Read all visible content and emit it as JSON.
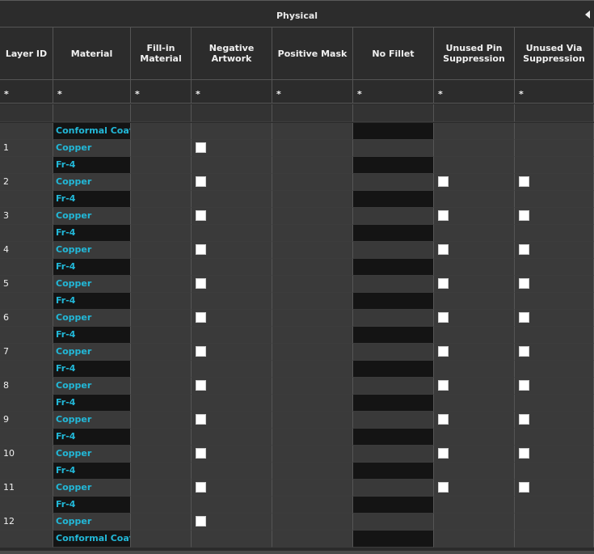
{
  "panel": {
    "title": "Physical"
  },
  "columns": [
    {
      "key": "layer_id",
      "label": "Layer ID"
    },
    {
      "key": "material",
      "label": "Material"
    },
    {
      "key": "fill_in",
      "label": "Fill-in\nMaterial"
    },
    {
      "key": "neg_art",
      "label": "Negative Artwork"
    },
    {
      "key": "pos_mask",
      "label": "Positive Mask"
    },
    {
      "key": "no_fillet",
      "label": "No Fillet"
    },
    {
      "key": "unused_pin",
      "label": "Unused Pin\nSuppression"
    },
    {
      "key": "unused_via",
      "label": "Unused Via\nSuppression"
    }
  ],
  "filter_row": [
    "*",
    "*",
    "*",
    "*",
    "*",
    "*",
    "*",
    "*"
  ],
  "rows": [
    {
      "layer_id": "",
      "material": "Conformal Coat",
      "neg": false,
      "pin": false,
      "via": false
    },
    {
      "layer_id": "1",
      "material": "Copper",
      "neg": true,
      "pin": false,
      "via": false
    },
    {
      "layer_id": "",
      "material": "Fr-4",
      "neg": false,
      "pin": false,
      "via": false
    },
    {
      "layer_id": "2",
      "material": "Copper",
      "neg": true,
      "pin": true,
      "via": true
    },
    {
      "layer_id": "",
      "material": "Fr-4",
      "neg": false,
      "pin": false,
      "via": false
    },
    {
      "layer_id": "3",
      "material": "Copper",
      "neg": true,
      "pin": true,
      "via": true
    },
    {
      "layer_id": "",
      "material": "Fr-4",
      "neg": false,
      "pin": false,
      "via": false
    },
    {
      "layer_id": "4",
      "material": "Copper",
      "neg": true,
      "pin": true,
      "via": true
    },
    {
      "layer_id": "",
      "material": "Fr-4",
      "neg": false,
      "pin": false,
      "via": false
    },
    {
      "layer_id": "5",
      "material": "Copper",
      "neg": true,
      "pin": true,
      "via": true
    },
    {
      "layer_id": "",
      "material": "Fr-4",
      "neg": false,
      "pin": false,
      "via": false
    },
    {
      "layer_id": "6",
      "material": "Copper",
      "neg": true,
      "pin": true,
      "via": true
    },
    {
      "layer_id": "",
      "material": "Fr-4",
      "neg": false,
      "pin": false,
      "via": false
    },
    {
      "layer_id": "7",
      "material": "Copper",
      "neg": true,
      "pin": true,
      "via": true
    },
    {
      "layer_id": "",
      "material": "Fr-4",
      "neg": false,
      "pin": false,
      "via": false
    },
    {
      "layer_id": "8",
      "material": "Copper",
      "neg": true,
      "pin": true,
      "via": true
    },
    {
      "layer_id": "",
      "material": "Fr-4",
      "neg": false,
      "pin": false,
      "via": false
    },
    {
      "layer_id": "9",
      "material": "Copper",
      "neg": true,
      "pin": true,
      "via": true
    },
    {
      "layer_id": "",
      "material": "Fr-4",
      "neg": false,
      "pin": false,
      "via": false
    },
    {
      "layer_id": "10",
      "material": "Copper",
      "neg": true,
      "pin": true,
      "via": true
    },
    {
      "layer_id": "",
      "material": "Fr-4",
      "neg": false,
      "pin": false,
      "via": false
    },
    {
      "layer_id": "11",
      "material": "Copper",
      "neg": true,
      "pin": true,
      "via": true
    },
    {
      "layer_id": "",
      "material": "Fr-4",
      "neg": false,
      "pin": false,
      "via": false
    },
    {
      "layer_id": "12",
      "material": "Copper",
      "neg": true,
      "pin": false,
      "via": false
    },
    {
      "layer_id": "",
      "material": "Conformal Coat",
      "neg": false,
      "pin": false,
      "via": false
    }
  ],
  "icons": {
    "collapse": "triangle-left-icon",
    "checkbox": "checkbox-unchecked-icon"
  }
}
